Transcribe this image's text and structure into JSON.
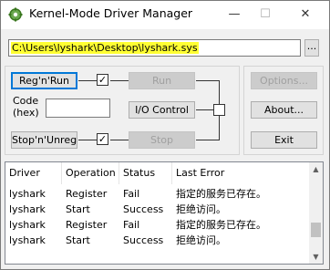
{
  "window": {
    "title": "Kernel-Mode Driver Manager",
    "controls": {
      "minimize": "—",
      "maximize": "☐",
      "close": "✕"
    }
  },
  "path": {
    "value": "C:\\Users\\lyshark\\Desktop\\lyshark.sys",
    "browse_label": "..."
  },
  "buttons": {
    "register": "Reg'n'Run",
    "unregister": "Stop'n'Unreg",
    "run": "Run",
    "io_control": "I/O Control",
    "stop": "Stop",
    "options": "Options...",
    "about": "About...",
    "exit": "Exit"
  },
  "code": {
    "label_line1": "Code",
    "label_line2": "(hex)",
    "value": ""
  },
  "log": {
    "columns": [
      "Driver",
      "Operation",
      "Status",
      "Last Error"
    ],
    "rows": [
      {
        "driver": "lyshark",
        "operation": "Register",
        "status": "Fail",
        "error": "指定的服务已存在。"
      },
      {
        "driver": "lyshark",
        "operation": "Start",
        "status": "Success",
        "error": "拒绝访问。"
      },
      {
        "driver": "lyshark",
        "operation": "Register",
        "status": "Fail",
        "error": "指定的服务已存在。"
      },
      {
        "driver": "lyshark",
        "operation": "Start",
        "status": "Success",
        "error": "拒绝访问。"
      }
    ]
  },
  "colors": {
    "highlight": "#ffff33",
    "focus": "#0078d7"
  }
}
